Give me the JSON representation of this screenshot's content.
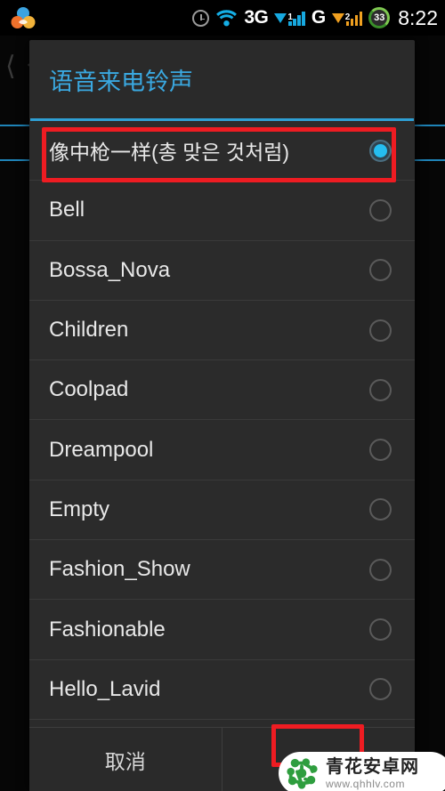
{
  "statusbar": {
    "icons": [
      {
        "name": "app-logo-icon",
        "label": ""
      },
      {
        "name": "alarm-clock-icon",
        "label": ""
      },
      {
        "name": "wifi-icon",
        "label": ""
      },
      {
        "name": "network-3g-icon",
        "label": "3G"
      },
      {
        "name": "signal-sim1-icon",
        "label": "1"
      },
      {
        "name": "network-g-icon",
        "label": "G"
      },
      {
        "name": "signal-sim2-icon",
        "label": "2"
      }
    ],
    "network_3g": "3G",
    "network_g": "G",
    "sim1_index": "1",
    "sim2_index": "2",
    "battery_percent": "33",
    "time": "8:22"
  },
  "dialog": {
    "title": "语音来电铃声",
    "items": [
      {
        "label": "像中枪一样(총 맞은 것처럼)",
        "selected": true,
        "cjk": true
      },
      {
        "label": "Bell",
        "selected": false,
        "cjk": false
      },
      {
        "label": "Bossa_Nova",
        "selected": false,
        "cjk": false
      },
      {
        "label": "Children",
        "selected": false,
        "cjk": false
      },
      {
        "label": "Coolpad",
        "selected": false,
        "cjk": false
      },
      {
        "label": "Dreampool",
        "selected": false,
        "cjk": false
      },
      {
        "label": "Empty",
        "selected": false,
        "cjk": false
      },
      {
        "label": "Fashion_Show",
        "selected": false,
        "cjk": false
      },
      {
        "label": "Fashionable",
        "selected": false,
        "cjk": false
      },
      {
        "label": "Hello_Lavid",
        "selected": false,
        "cjk": false
      }
    ],
    "buttons": {
      "cancel": "取消",
      "confirm": ""
    }
  },
  "watermark": {
    "name": "青花安卓网",
    "url": "www.qhhlv.com"
  },
  "colors": {
    "accent": "#3aa8e0",
    "title_rule": "#2e9fd4",
    "radio_on": "#25bdf0",
    "annotation": "#ee1c22",
    "dialog_bg": "#2a2a2a",
    "row_text": "#e8e8e8",
    "watermark_green": "#2f9e3f"
  }
}
